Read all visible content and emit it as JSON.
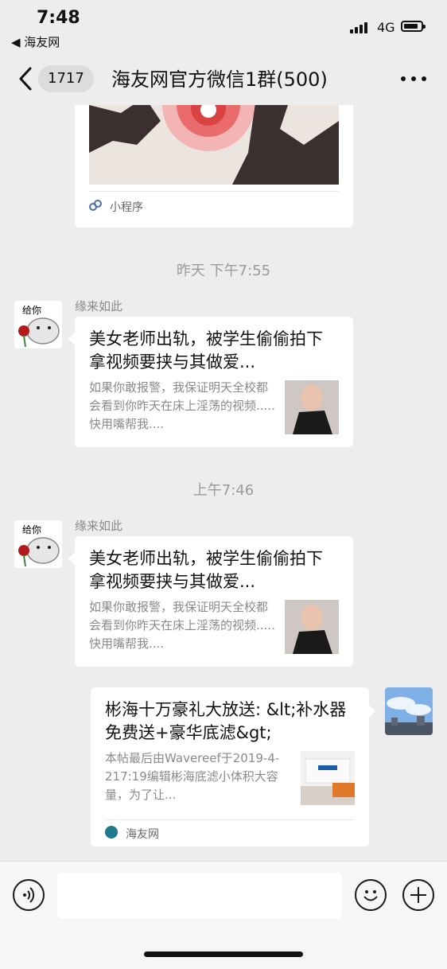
{
  "status_bar": {
    "time": "7:48",
    "back_app": "◀ 海友网",
    "network": "4G"
  },
  "nav": {
    "unread_count": "1717",
    "title": "海友网官方微信1群(500)"
  },
  "chat": {
    "mini_program": {
      "label": "小程序"
    },
    "messages": [
      {
        "timestamp": "昨天 下午7:55",
        "sender": "缘来如此",
        "avatar_caption": "给你",
        "title": "美女老师出轨，被学生偷偷拍下拿视频要挟与其做爱...",
        "desc": "如果你敢报警，我保证明天全校都会看到你昨天在床上淫荡的视频.....快用嘴帮我...."
      },
      {
        "timestamp": "上午7:46",
        "sender": "缘来如此",
        "avatar_caption": "给你",
        "title": "美女老师出轨，被学生偷偷拍下拿视频要挟与其做爱...",
        "desc": "如果你敢报警，我保证明天全校都会看到你昨天在床上淫荡的视频.....快用嘴帮我...."
      }
    ],
    "outgoing": {
      "title": "彬海十万豪礼大放送: &lt;补水器免费送+豪华底滤&gt;",
      "desc": "本帖最后由Wavereef于2019-4-217:19编辑彬海底滤小体积大容量，为了让...",
      "source": "海友网"
    }
  },
  "colors": {
    "background": "#ededed",
    "bubble": "#ffffff",
    "muted_text": "#8a8a8a"
  }
}
